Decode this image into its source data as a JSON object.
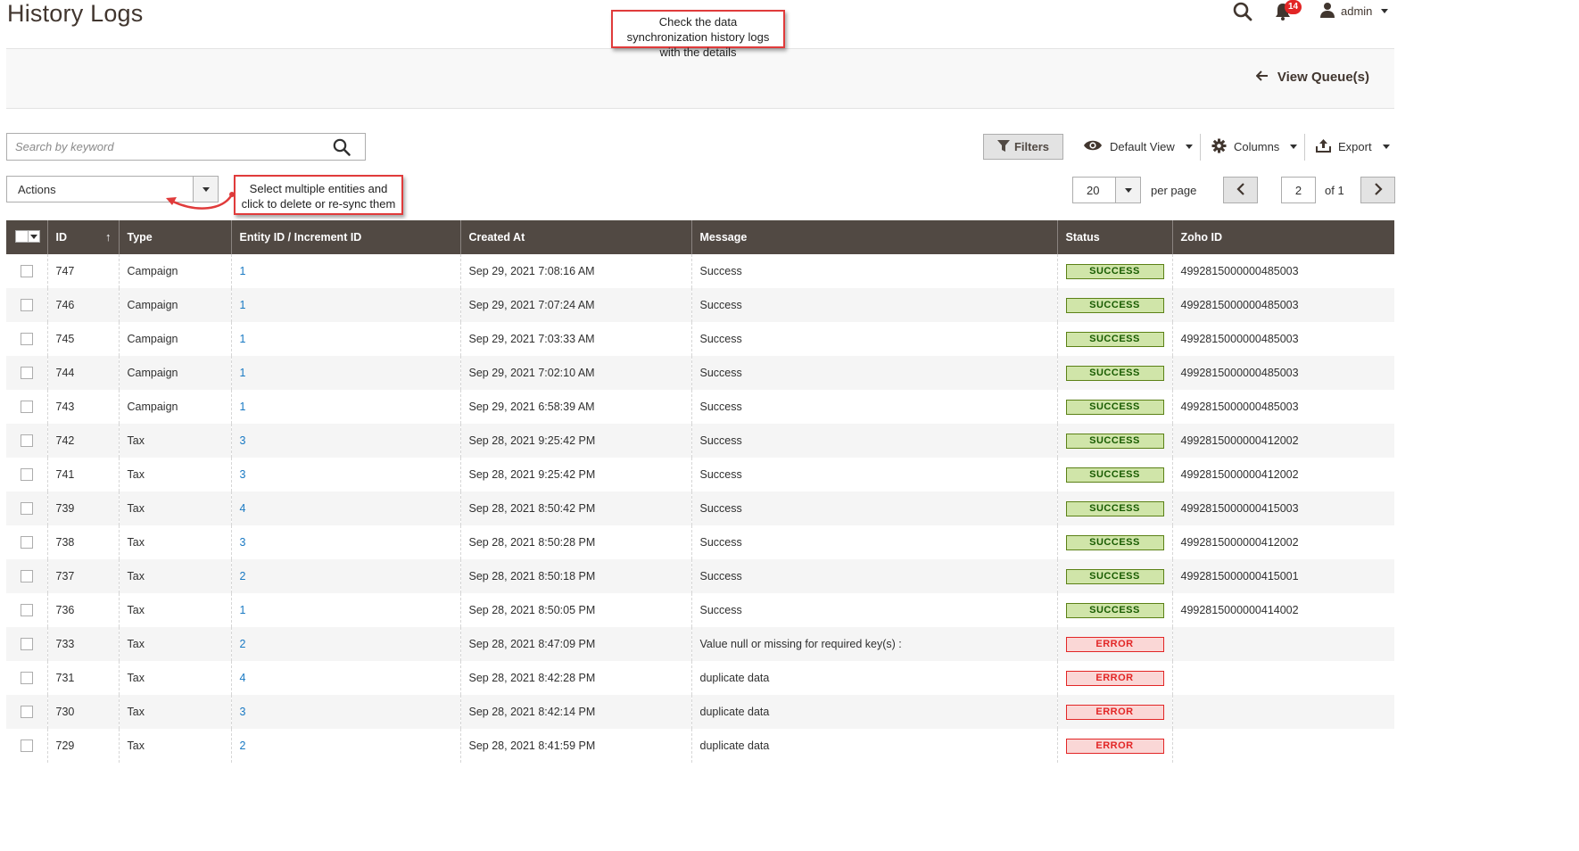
{
  "header": {
    "title": "History Logs",
    "notification_count": "14",
    "user": "admin"
  },
  "callouts": {
    "top": "Check the data synchronization history logs with the details",
    "actions": "Select multiple entities and click to delete or re-sync them"
  },
  "queue_bar": {
    "view_queue_label": "View Queue(s)"
  },
  "search": {
    "placeholder": "Search by keyword"
  },
  "toolbar": {
    "filters_label": "Filters",
    "view_label": "Default View",
    "columns_label": "Columns",
    "export_label": "Export"
  },
  "actions": {
    "label": "Actions"
  },
  "pager": {
    "per_page_value": "20",
    "per_page_label": "per page",
    "current_page": "2",
    "of_label": "of 1"
  },
  "table": {
    "columns": [
      "ID",
      "Type",
      "Entity ID / Increment ID",
      "Created At",
      "Message",
      "Status",
      "Zoho ID"
    ],
    "rows": [
      {
        "id": "747",
        "type": "Campaign",
        "entity": "1",
        "created": "Sep 29, 2021 7:08:16 AM",
        "message": "Success",
        "status": "SUCCESS",
        "zoho": "4992815000000485003"
      },
      {
        "id": "746",
        "type": "Campaign",
        "entity": "1",
        "created": "Sep 29, 2021 7:07:24 AM",
        "message": "Success",
        "status": "SUCCESS",
        "zoho": "4992815000000485003"
      },
      {
        "id": "745",
        "type": "Campaign",
        "entity": "1",
        "created": "Sep 29, 2021 7:03:33 AM",
        "message": "Success",
        "status": "SUCCESS",
        "zoho": "4992815000000485003"
      },
      {
        "id": "744",
        "type": "Campaign",
        "entity": "1",
        "created": "Sep 29, 2021 7:02:10 AM",
        "message": "Success",
        "status": "SUCCESS",
        "zoho": "4992815000000485003"
      },
      {
        "id": "743",
        "type": "Campaign",
        "entity": "1",
        "created": "Sep 29, 2021 6:58:39 AM",
        "message": "Success",
        "status": "SUCCESS",
        "zoho": "4992815000000485003"
      },
      {
        "id": "742",
        "type": "Tax",
        "entity": "3",
        "created": "Sep 28, 2021 9:25:42 PM",
        "message": "Success",
        "status": "SUCCESS",
        "zoho": "4992815000000412002"
      },
      {
        "id": "741",
        "type": "Tax",
        "entity": "3",
        "created": "Sep 28, 2021 9:25:42 PM",
        "message": "Success",
        "status": "SUCCESS",
        "zoho": "4992815000000412002"
      },
      {
        "id": "739",
        "type": "Tax",
        "entity": "4",
        "created": "Sep 28, 2021 8:50:42 PM",
        "message": "Success",
        "status": "SUCCESS",
        "zoho": "4992815000000415003"
      },
      {
        "id": "738",
        "type": "Tax",
        "entity": "3",
        "created": "Sep 28, 2021 8:50:28 PM",
        "message": "Success",
        "status": "SUCCESS",
        "zoho": "4992815000000412002"
      },
      {
        "id": "737",
        "type": "Tax",
        "entity": "2",
        "created": "Sep 28, 2021 8:50:18 PM",
        "message": "Success",
        "status": "SUCCESS",
        "zoho": "4992815000000415001"
      },
      {
        "id": "736",
        "type": "Tax",
        "entity": "1",
        "created": "Sep 28, 2021 8:50:05 PM",
        "message": "Success",
        "status": "SUCCESS",
        "zoho": "4992815000000414002"
      },
      {
        "id": "733",
        "type": "Tax",
        "entity": "2",
        "created": "Sep 28, 2021 8:47:09 PM",
        "message": "Value null or missing for required key(s) :",
        "status": "ERROR",
        "zoho": ""
      },
      {
        "id": "731",
        "type": "Tax",
        "entity": "4",
        "created": "Sep 28, 2021 8:42:28 PM",
        "message": "duplicate data",
        "status": "ERROR",
        "zoho": ""
      },
      {
        "id": "730",
        "type": "Tax",
        "entity": "3",
        "created": "Sep 28, 2021 8:42:14 PM",
        "message": "duplicate data",
        "status": "ERROR",
        "zoho": ""
      },
      {
        "id": "729",
        "type": "Tax",
        "entity": "2",
        "created": "Sep 28, 2021 8:41:59 PM",
        "message": "duplicate data",
        "status": "ERROR",
        "zoho": ""
      }
    ]
  },
  "colors": {
    "header_bg": "#514943",
    "link": "#1979c3",
    "success_bg": "#d0e5a9",
    "error_bg": "#fad7d6",
    "callout_border": "#e03b3b"
  }
}
